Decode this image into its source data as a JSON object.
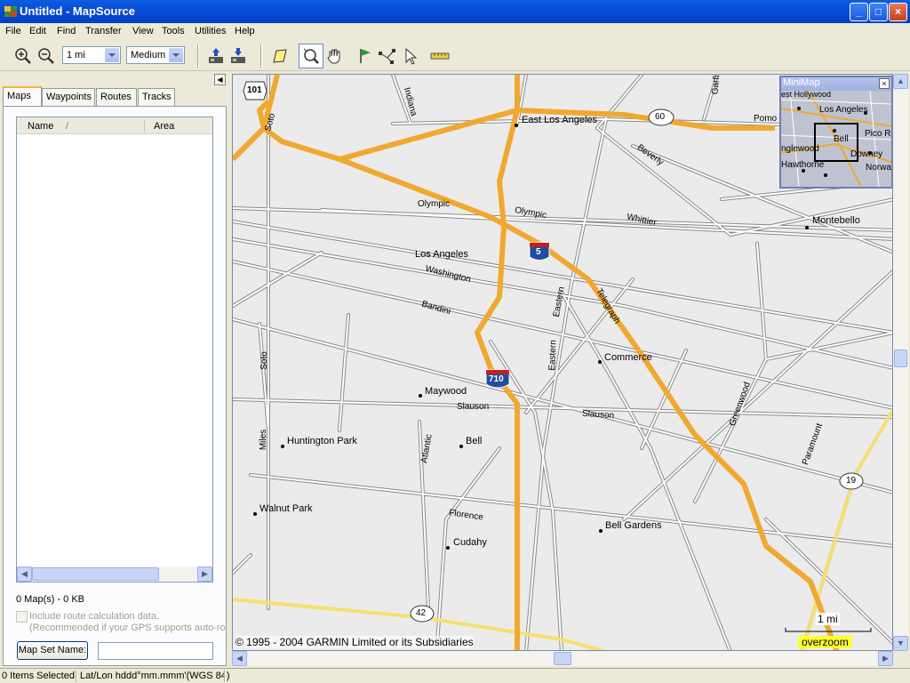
{
  "window": {
    "title": "Untitled - MapSource",
    "controls": [
      "_",
      "□",
      "×"
    ]
  },
  "menu": [
    "File",
    "Edit",
    "Find",
    "Transfer",
    "View",
    "Tools",
    "Utilities",
    "Help"
  ],
  "toolbar": {
    "zoom_value": "1 mi",
    "detail_value": "Medium",
    "icons": [
      "zoom-in-icon",
      "zoom-out-icon",
      "receive-from-device-icon",
      "send-to-device-icon",
      "map-tool-icon",
      "zoom-tool-icon",
      "pan-hand-icon",
      "waypoint-flag-icon",
      "route-tool-icon",
      "select-arrow-icon",
      "measure-ruler-icon"
    ]
  },
  "left_panel": {
    "tabs": [
      "Maps",
      "Waypoints",
      "Routes",
      "Tracks"
    ],
    "active_tab": "Maps",
    "columns": [
      "Name",
      "/",
      "Area"
    ],
    "summary": "0 Map(s) - 0 KB",
    "include_route_label": "Include route calculation data.",
    "include_route_note": "(Recommended if your GPS supports auto-rou",
    "map_set_button": "Map Set Name:",
    "map_set_value": ""
  },
  "map": {
    "city_labels": [
      {
        "name": "East Los Angeles",
        "key": "ela"
      },
      {
        "name": "Montebello",
        "key": "mon"
      },
      {
        "name": "Los Angeles",
        "key": "la"
      },
      {
        "name": "Commerce",
        "key": "com"
      },
      {
        "name": "Maywood",
        "key": "may"
      },
      {
        "name": "Huntington Park",
        "key": "hp"
      },
      {
        "name": "Bell",
        "key": "bell"
      },
      {
        "name": "Walnut Park",
        "key": "wp"
      },
      {
        "name": "Bell Gardens",
        "key": "bg"
      },
      {
        "name": "Cudahy",
        "key": "cud"
      }
    ],
    "street_labels": {
      "indiana": "Indiana",
      "soto1": "Soto",
      "soto2": "Soto",
      "pomona": "Pomo",
      "garfield": "Garfi",
      "beverly": "Beverly",
      "olympic1": "Olympic",
      "olympic2": "Olympic",
      "whittier": "Whittier",
      "washington": "Washington",
      "bandini": "Bandini",
      "eastern1": "Eastern",
      "eastern2": "Eastern",
      "telegraph": "Telegraph",
      "slauson1": "Slauson",
      "slauson2": "Slauson",
      "greenwood": "Greenwood",
      "paramount": "Paramount",
      "miles": "Miles",
      "atlantic": "Atlantic",
      "florence": "Florence"
    },
    "shields": {
      "us101": "101",
      "i5": "5",
      "i710": "710",
      "ca60": "60",
      "ca19": "19",
      "ca42": "42"
    },
    "copyright": "© 1995 - 2004 GARMIN Limited or its Subsidiaries",
    "scale_label": "1 mi",
    "overzoom_label": "overzoom"
  },
  "minimap": {
    "title": "MiniMap",
    "close": "×",
    "labels": [
      "est Hollywood",
      "Los Angeles",
      "Pico R",
      "Bell",
      "nglewood",
      "Downey",
      "Hawthorne",
      "Norwa"
    ]
  },
  "statusbar": {
    "selection": "0 Items Selected",
    "coordinate_format": "Lat/Lon hddd°mm.mmm'(WGS 84)"
  },
  "colors": {
    "freeway": "#f0a830",
    "highway": "#f5e070",
    "street": "#ffffff",
    "map_bg": "#ebebeb",
    "title_bar": "#0a49d6"
  }
}
